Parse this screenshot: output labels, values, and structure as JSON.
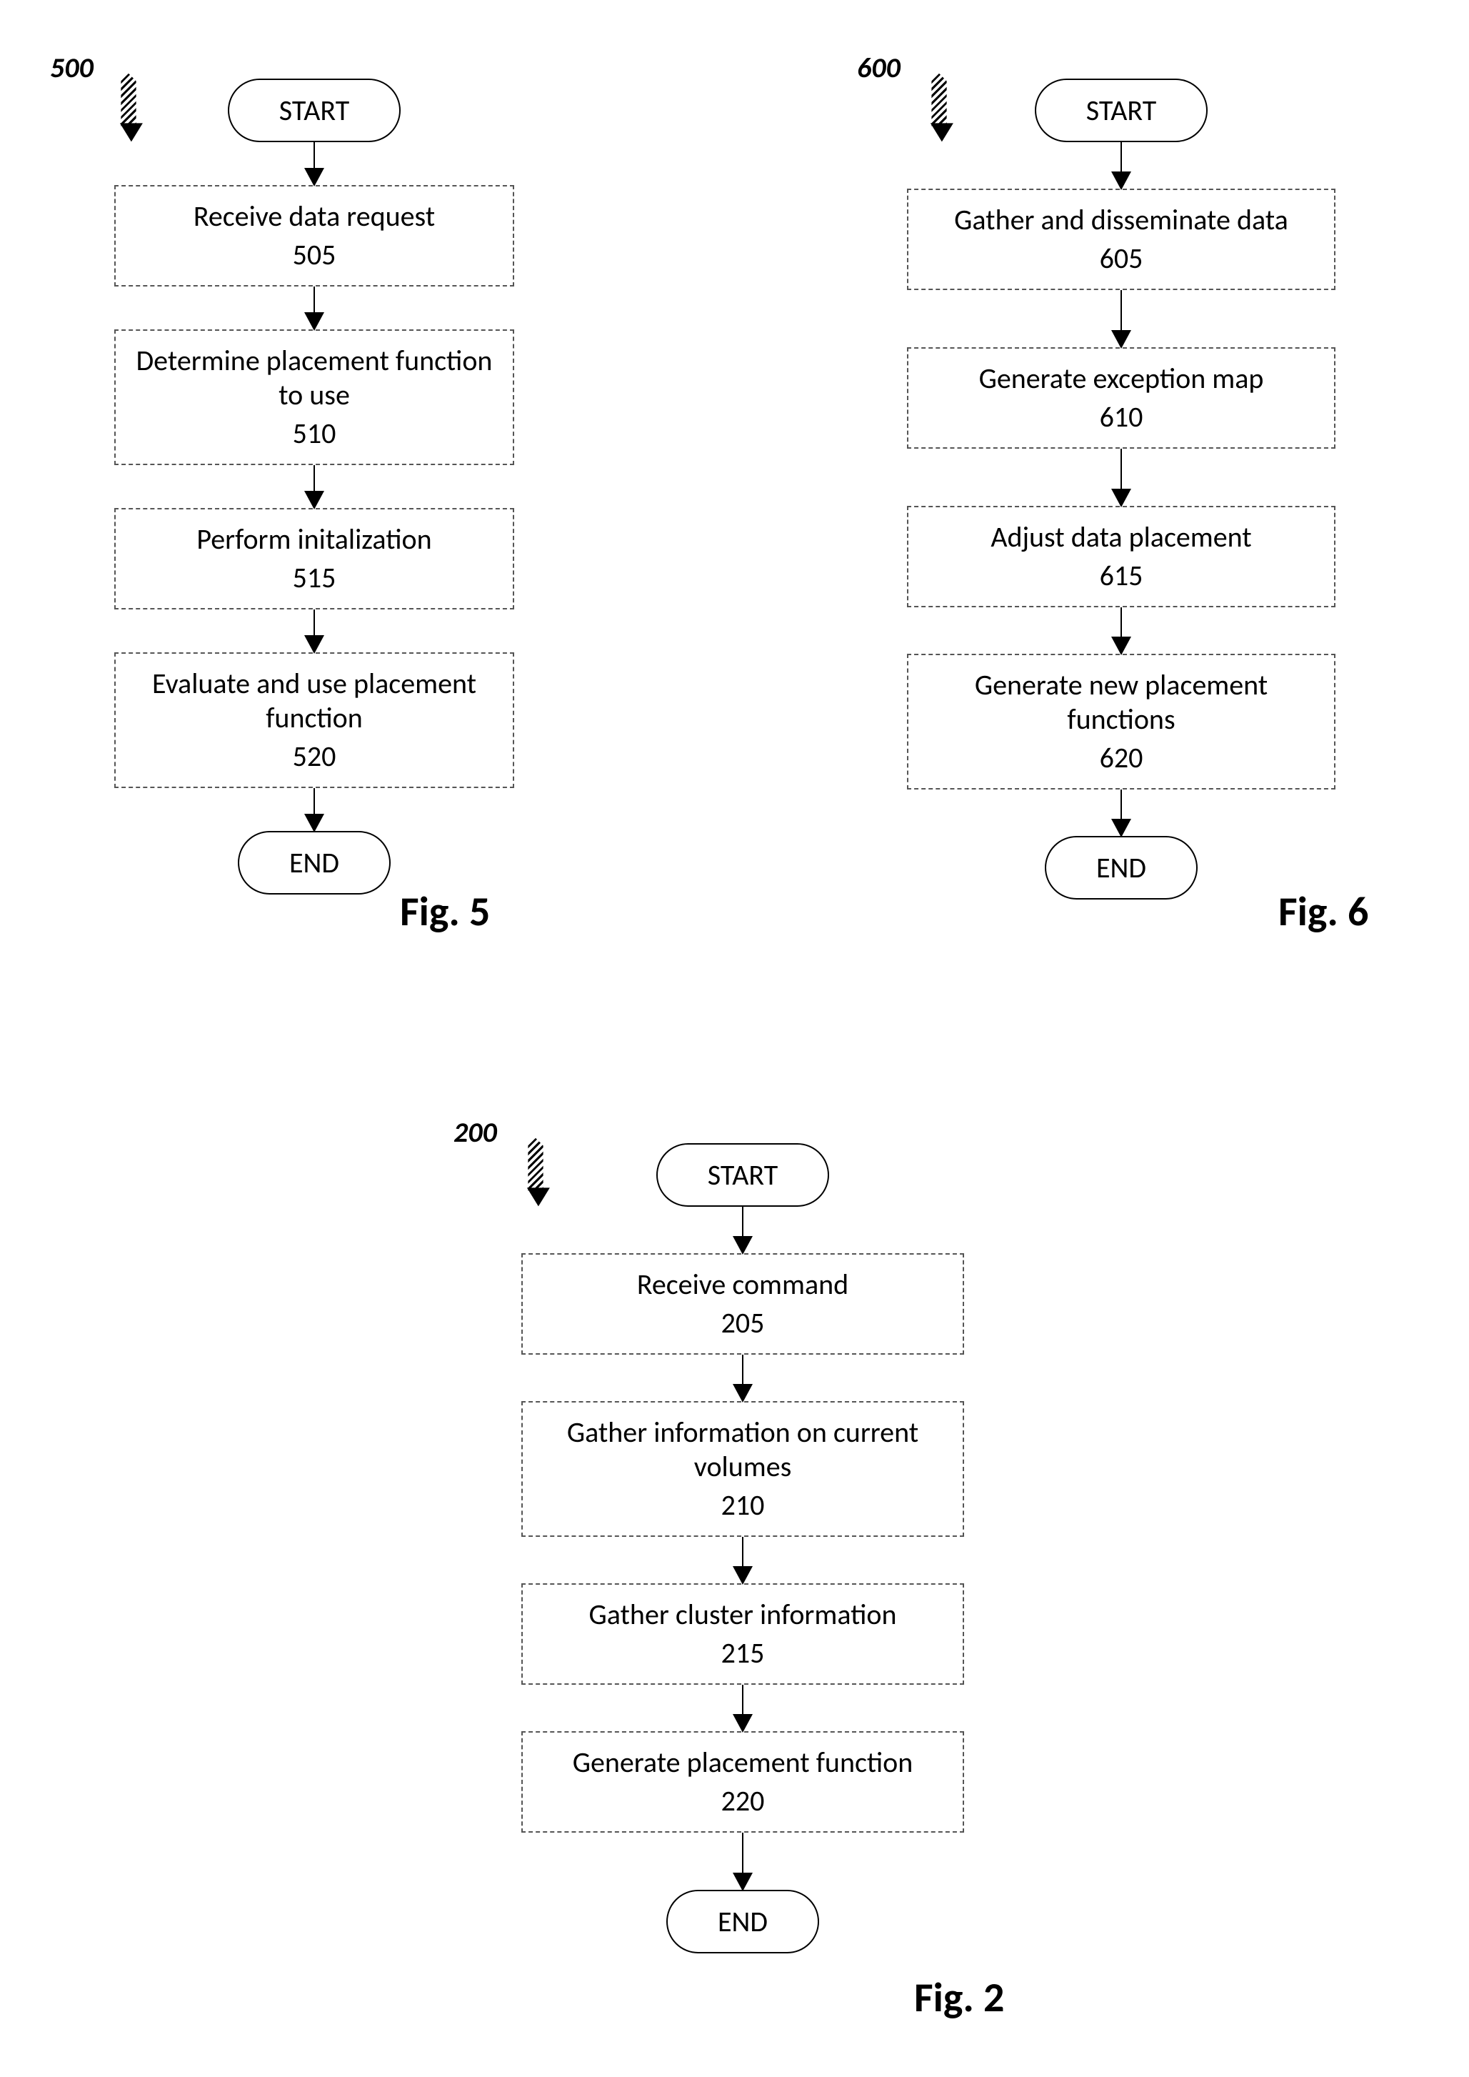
{
  "chart_data": [
    {
      "type": "flowchart",
      "id": "500",
      "caption": "Fig. 5",
      "terminals": {
        "start": "START",
        "end": "END"
      },
      "steps": [
        {
          "label": "Receive data request",
          "num": "505"
        },
        {
          "label": "Determine placement function to use",
          "num": "510"
        },
        {
          "label": "Perform initalization",
          "num": "515"
        },
        {
          "label": "Evaluate and use placement function",
          "num": "520"
        }
      ]
    },
    {
      "type": "flowchart",
      "id": "600",
      "caption": "Fig. 6",
      "terminals": {
        "start": "START",
        "end": "END"
      },
      "steps": [
        {
          "label": "Gather and disseminate data",
          "num": "605"
        },
        {
          "label": "Generate exception map",
          "num": "610"
        },
        {
          "label": "Adjust data placement",
          "num": "615"
        },
        {
          "label": "Generate new placement functions",
          "num": "620"
        }
      ]
    },
    {
      "type": "flowchart",
      "id": "200",
      "caption": "Fig. 2",
      "terminals": {
        "start": "START",
        "end": "END"
      },
      "steps": [
        {
          "label": "Receive command",
          "num": "205"
        },
        {
          "label": "Gather information on current volumes",
          "num": "210"
        },
        {
          "label": "Gather cluster information",
          "num": "215"
        },
        {
          "label": "Generate placement function",
          "num": "220"
        }
      ]
    }
  ]
}
